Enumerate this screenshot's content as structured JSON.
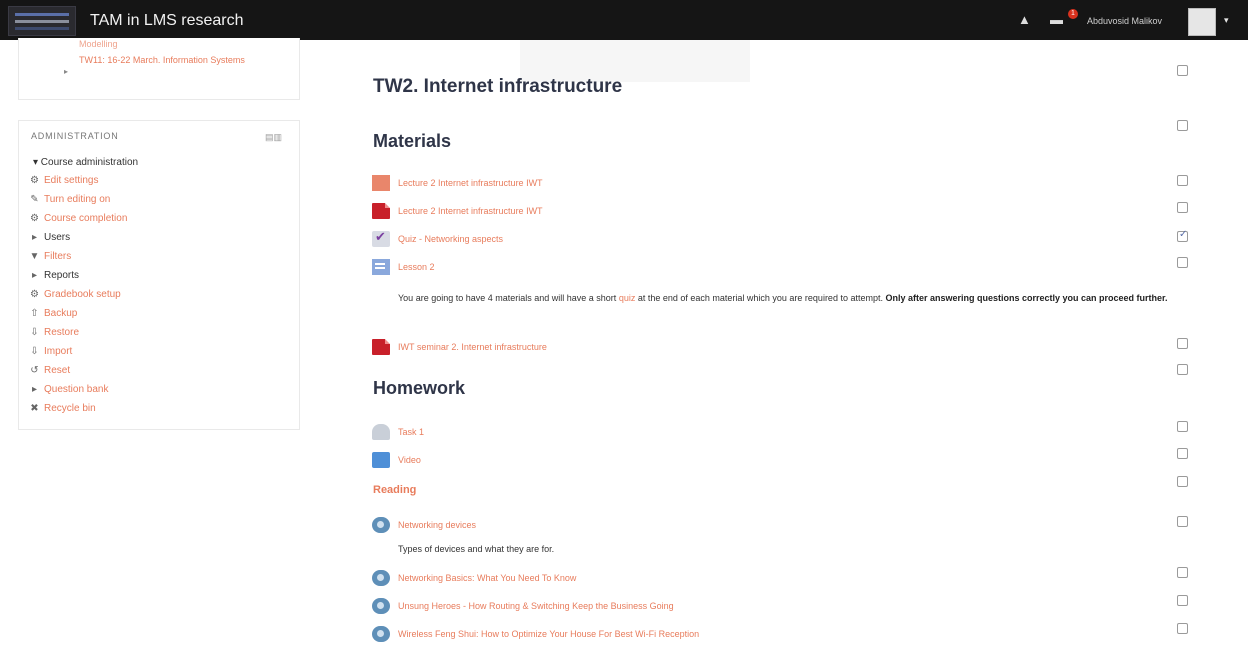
{
  "navbar": {
    "site_title": "TAM in LMS research",
    "bell_icon": "▲",
    "message_icon": "▬",
    "message_count": "1",
    "user_name": "Abduvosid Malikov",
    "caret": "▾"
  },
  "nav_block": {
    "item_top": "Modelling",
    "item_label": "TW11: 16-22 March. Information Systems",
    "arrow": "▸"
  },
  "admin": {
    "heading": "ADMINISTRATION",
    "dock_icon": "▤▥",
    "section_label": "▾ Course administration",
    "items": [
      {
        "icon": "⚙",
        "label": "Edit settings",
        "link": true
      },
      {
        "icon": "✎",
        "label": "Turn editing on",
        "link": true
      },
      {
        "icon": "⚙",
        "label": "Course completion",
        "link": true
      },
      {
        "icon": "▸",
        "label": "Users",
        "link": false
      },
      {
        "icon": "▼",
        "label": "Filters",
        "link": true
      },
      {
        "icon": "▸",
        "label": "Reports",
        "link": false
      },
      {
        "icon": "⚙",
        "label": "Gradebook setup",
        "link": true
      },
      {
        "icon": "⇧",
        "label": "Backup",
        "link": true
      },
      {
        "icon": "⇩",
        "label": "Restore",
        "link": true
      },
      {
        "icon": "⇩",
        "label": "Import",
        "link": true
      },
      {
        "icon": "↺",
        "label": "Reset",
        "link": true
      },
      {
        "icon": "▸",
        "label": "Question bank",
        "link": true
      },
      {
        "icon": "✖",
        "label": "Recycle bin",
        "link": true
      }
    ]
  },
  "main": {
    "section_title": "TW2. Internet infrastructure",
    "materials_heading": "Materials",
    "materials": [
      {
        "label": "Lecture 2 Internet infrastructure IWT",
        "icon": "ppt-icon",
        "checked": false
      },
      {
        "label": "Lecture 2 Internet infrastructure IWT",
        "icon": "pdf-icon",
        "checked": false
      },
      {
        "label": "Quiz - Networking aspects",
        "icon": "quiz-icon",
        "checked": true
      },
      {
        "label": "Lesson 2",
        "icon": "lesson-icon",
        "checked": false
      }
    ],
    "description_part1": "You are going to have 4 materials and will have a short ",
    "description_link": "quiz",
    "description_part2": " at the end of each material which you are required to attempt. ",
    "description_bold": "Only after answering questions correctly you can proceed further.",
    "seminar": {
      "label": "IWT seminar 2. Internet infrastructure",
      "icon": "pdf-icon",
      "checked": false
    },
    "homework_heading": "Homework",
    "homework": [
      {
        "label": "Task 1",
        "icon": "assignment-icon",
        "checked": false
      },
      {
        "label": "Video",
        "icon": "folder-icon",
        "checked": false
      }
    ],
    "reading_heading": "Reading",
    "reading": [
      {
        "label": "Networking devices",
        "icon": "url-icon",
        "checked": false
      },
      {
        "label": "Networking Basics: What You Need To Know",
        "icon": "url-icon",
        "checked": false
      },
      {
        "label": "Unsung Heroes - How Routing & Switching Keep the Business Going",
        "icon": "url-icon",
        "checked": false
      },
      {
        "label": "Wireless Feng Shui: How to Optimize Your House For Best Wi-Fi Reception",
        "icon": "url-icon",
        "checked": false
      }
    ],
    "reading_description": "Types of devices and what they are for."
  }
}
